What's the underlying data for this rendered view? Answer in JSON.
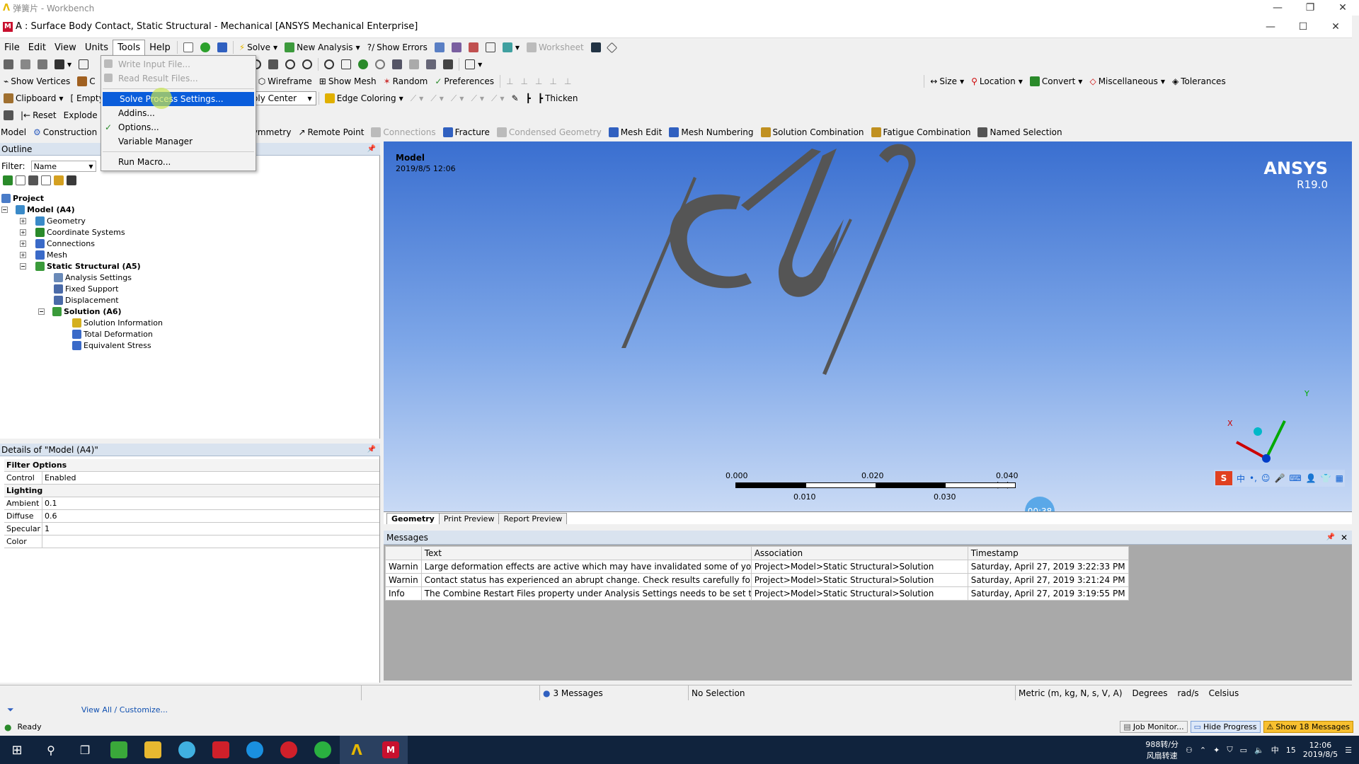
{
  "workbench_title": "弹簧片 - Workbench",
  "window_title": "A : Surface Body Contact, Static Structural - Mechanical [ANSYS Mechanical Enterprise]",
  "menu": [
    "File",
    "Edit",
    "View",
    "Units",
    "Tools",
    "Help"
  ],
  "toolbar1": {
    "solve": "Solve",
    "new_analysis": "New Analysis",
    "show_errors": "Show Errors",
    "worksheet": "Worksheet"
  },
  "toolbar3": {
    "show_vertices": "Show Vertices",
    "wireframe": "Wireframe",
    "show_mesh": "Show Mesh",
    "random": "Random",
    "preferences": "Preferences",
    "size": "Size",
    "location": "Location",
    "convert": "Convert",
    "miscellaneous": "Miscellaneous",
    "tolerances": "Tolerances"
  },
  "toolbar4": {
    "clipboard": "Clipboard",
    "empty": "[ Empty",
    "assembly_center": "embly Center",
    "edge_coloring": "Edge Coloring",
    "thicken": "Thicken"
  },
  "toolbar5": {
    "reset": "Reset",
    "explode": "Explode"
  },
  "toolbar6": {
    "model": "Model",
    "construction": "Construction",
    "symmetry": "Symmetry",
    "remote_point": "Remote Point",
    "connections": "Connections",
    "fracture": "Fracture",
    "condensed_geometry": "Condensed Geometry",
    "mesh_edit": "Mesh Edit",
    "mesh_numbering": "Mesh Numbering",
    "solution_combination": "Solution Combination",
    "fatigue_combination": "Fatigue Combination",
    "named_selection": "Named Selection"
  },
  "tools_menu": [
    {
      "label": "Write Input File...",
      "disabled": true
    },
    {
      "label": "Read Result Files...",
      "disabled": true
    },
    {
      "label": "Solve Process Settings...",
      "highlight": true
    },
    {
      "label": "Addins..."
    },
    {
      "label": "Options..."
    },
    {
      "label": "Variable Manager"
    },
    {
      "label": "Run Macro..."
    }
  ],
  "outline": {
    "title": "Outline",
    "filter_label": "Filter:",
    "filter_value": "Name",
    "tree": [
      "Project",
      "Model (A4)",
      "Geometry",
      "Coordinate Systems",
      "Connections",
      "Mesh",
      "Static Structural (A5)",
      "Analysis Settings",
      "Fixed Support",
      "Displacement",
      "Solution (A6)",
      "Solution Information",
      "Total Deformation",
      "Equivalent Stress"
    ]
  },
  "details": {
    "title": "Details of \"Model (A4)\"",
    "rows": [
      {
        "section": "Filter Options"
      },
      {
        "k": "Control",
        "v": "Enabled"
      },
      {
        "section": "Lighting"
      },
      {
        "k": "Ambient",
        "v": "0.1"
      },
      {
        "k": "Diffuse",
        "v": "0.6"
      },
      {
        "k": "Specular",
        "v": "1"
      },
      {
        "k": "Color",
        "v": ""
      }
    ]
  },
  "viewport": {
    "label": "Model",
    "timestamp": "2019/8/5 12:06",
    "brand": "ANSYS",
    "version": "R19.0",
    "scale": {
      "t0": "0.000",
      "t1": "0.010",
      "t2": "0.020",
      "t3": "0.030",
      "t4": "0.040 (m)"
    },
    "axis_x": "X",
    "axis_y": "Y",
    "timer": "00:38"
  },
  "viewport_tabs": [
    "Geometry",
    "Print Preview",
    "Report Preview"
  ],
  "messages": {
    "title": "Messages",
    "headers": [
      "",
      "Text",
      "Association",
      "Timestamp"
    ],
    "rows": [
      [
        "Warnin",
        "Large deformation effects are active which may have invalidated some of your",
        "Project>Model>Static Structural>Solution",
        "Saturday, April 27, 2019 3:22:33 PM"
      ],
      [
        "Warnin",
        "Contact status has experienced an abrupt change.  Check results carefully for p",
        "Project>Model>Static Structural>Solution",
        "Saturday, April 27, 2019 3:21:24 PM"
      ],
      [
        "Info",
        "The Combine Restart Files property under Analysis Settings needs to be set to",
        "Project>Model>Static Structural>Solution",
        "Saturday, April 27, 2019 3:19:55 PM"
      ]
    ]
  },
  "status": {
    "view_all": "View All / Customize...",
    "messages": "3 Messages",
    "selection": "No Selection",
    "units": "Metric (m, kg, N, s, V, A)",
    "angle": "Degrees",
    "rate": "rad/s",
    "temp": "Celsius"
  },
  "status2": {
    "ready": "Ready",
    "job_monitor": "Job Monitor...",
    "hide_progress": "Hide Progress",
    "show_messages": "Show 18 Messages"
  },
  "taskbar": {
    "speed": "988转/分",
    "fan": "风扇转速",
    "time": "12:06",
    "date": "2019/8/5",
    "ime": "中",
    "ime_num": "15"
  }
}
